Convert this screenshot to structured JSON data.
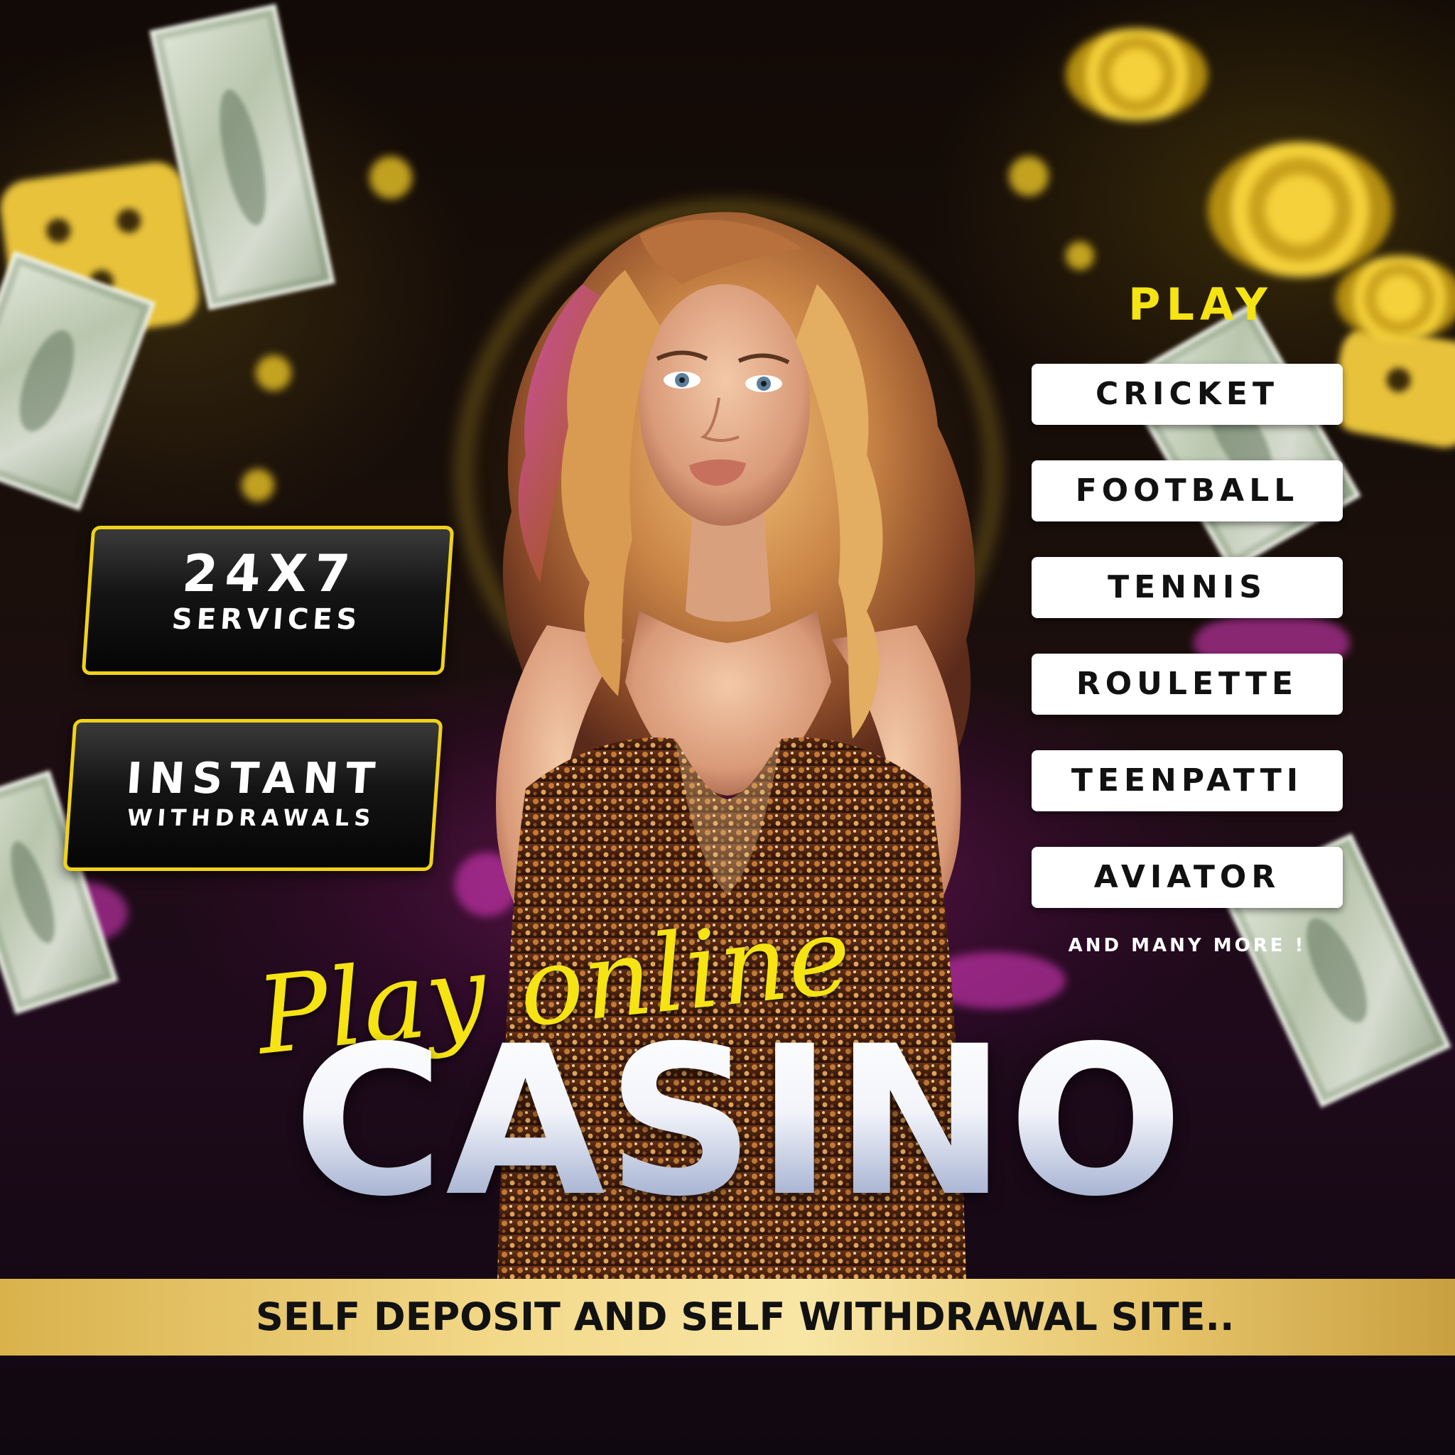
{
  "badges": {
    "services": {
      "big": "24X7",
      "small": "SERVICES"
    },
    "withdrawals": {
      "big": "INSTANT",
      "small": "WITHDRAWALS"
    }
  },
  "menu": {
    "heading": "PLAY",
    "items": [
      {
        "label": "CRICKET"
      },
      {
        "label": "FOOTBALL"
      },
      {
        "label": "TENNIS"
      },
      {
        "label": "ROULETTE"
      },
      {
        "label": "TEENPATTI"
      },
      {
        "label": "AVIATOR"
      }
    ],
    "footer_note": "AND MANY MORE !"
  },
  "headline": {
    "script": "Play online",
    "main": "CASINO"
  },
  "banner": {
    "text": "SELF DEPOSIT AND SELF WITHDRAWAL SITE.."
  },
  "colors": {
    "accent_yellow": "#f5e313",
    "badge_border": "#f0d21a",
    "banner_gold": "#f3d98a",
    "magenta_glow": "#e63cc8"
  },
  "icons": [
    "dice-icon",
    "casino-chip-icon",
    "banknote-icon"
  ]
}
